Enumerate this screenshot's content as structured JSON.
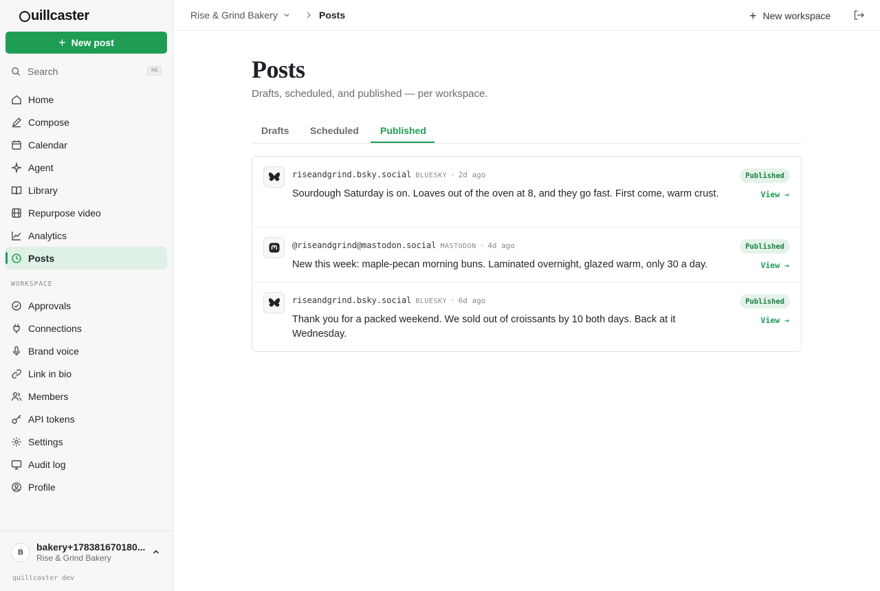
{
  "brand": {
    "name": "uillcaster",
    "accent": "#1f9d55"
  },
  "sidebar": {
    "new_post_label": "New post",
    "search": {
      "label": "Search",
      "shortcut": "⌘K"
    },
    "primary": [
      {
        "label": "Home",
        "icon": "home-icon"
      },
      {
        "label": "Compose",
        "icon": "pen-icon"
      },
      {
        "label": "Calendar",
        "icon": "calendar-icon"
      },
      {
        "label": "Agent",
        "icon": "sparkle-icon"
      },
      {
        "label": "Library",
        "icon": "book-icon"
      },
      {
        "label": "Repurpose video",
        "icon": "film-icon"
      },
      {
        "label": "Analytics",
        "icon": "chart-icon"
      },
      {
        "label": "Posts",
        "icon": "clock-icon",
        "active": true
      }
    ],
    "section_label": "WORKSPACE",
    "workspace": [
      {
        "label": "Approvals",
        "icon": "check-circle-icon"
      },
      {
        "label": "Connections",
        "icon": "plug-icon"
      },
      {
        "label": "Brand voice",
        "icon": "mic-icon"
      },
      {
        "label": "Link in bio",
        "icon": "link-icon"
      },
      {
        "label": "Members",
        "icon": "users-icon"
      },
      {
        "label": "API tokens",
        "icon": "key-icon"
      },
      {
        "label": "Settings",
        "icon": "gear-icon"
      },
      {
        "label": "Audit log",
        "icon": "monitor-icon"
      },
      {
        "label": "Profile",
        "icon": "user-circle-icon"
      }
    ],
    "user": {
      "initial": "B",
      "name": "bakery+178381670180...",
      "org": "Rise & Grind Bakery"
    },
    "env": "quillcaster dev"
  },
  "topbar": {
    "workspace": "Rise & Grind Bakery",
    "page": "Posts",
    "new_workspace_label": "New workspace"
  },
  "page": {
    "title": "Posts",
    "subtitle": "Drafts, scheduled, and published — per workspace.",
    "tabs": [
      {
        "label": "Drafts"
      },
      {
        "label": "Scheduled"
      },
      {
        "label": "Published",
        "active": true
      }
    ]
  },
  "posts": [
    {
      "handle": "riseandgrind.bsky.social",
      "network": "BLUESKY",
      "age": "2d ago",
      "text": "Sourdough Saturday is on. Loaves out of the oven at 8, and they go fast. First come, warm crust.",
      "status": "Published",
      "action": "View →",
      "icon": "butterfly-icon"
    },
    {
      "handle": "@riseandgrind@mastodon.social",
      "network": "MASTODON",
      "age": "4d ago",
      "text": "New this week: maple-pecan morning buns. Laminated overnight, glazed warm, only 30 a day.",
      "status": "Published",
      "action": "View →",
      "icon": "mastodon-icon"
    },
    {
      "handle": "riseandgrind.bsky.social",
      "network": "BLUESKY",
      "age": "6d ago",
      "text": "Thank you for a packed weekend. We sold out of croissants by 10 both days. Back at it Wednesday.",
      "status": "Published",
      "action": "View →",
      "icon": "butterfly-icon"
    }
  ]
}
